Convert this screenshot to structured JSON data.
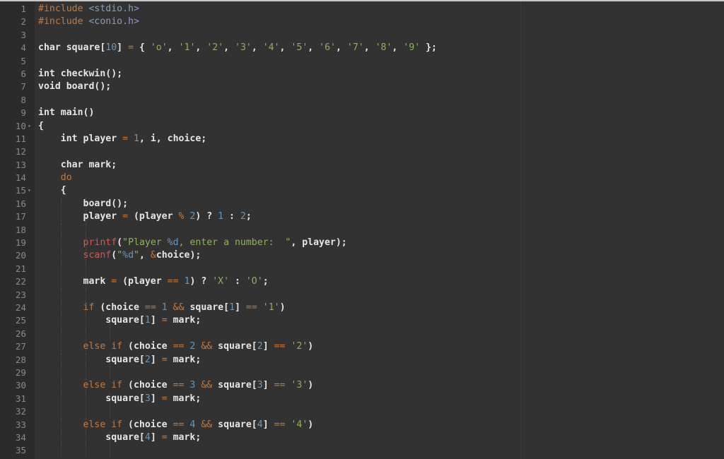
{
  "editor": {
    "language": "c",
    "colors": {
      "background": "#323232",
      "gutter": "#2b2b2b",
      "keyword": "#cc7832",
      "number": "#6897bb",
      "string": "#8fb15a",
      "function": "#d05a4e",
      "text": "#e6e6e6"
    },
    "lines": [
      {
        "n": "1",
        "fold": "",
        "indent": 0,
        "tokens": [
          [
            "pre",
            "#include"
          ],
          [
            "pl",
            " "
          ],
          [
            "inc",
            "<stdio.h>"
          ]
        ]
      },
      {
        "n": "2",
        "fold": "",
        "indent": 0,
        "tokens": [
          [
            "pre",
            "#include"
          ],
          [
            "pl",
            " "
          ],
          [
            "inc",
            "<conio.h>"
          ]
        ]
      },
      {
        "n": "3",
        "fold": "",
        "indent": 0,
        "tokens": []
      },
      {
        "n": "4",
        "fold": "",
        "indent": 0,
        "tokens": [
          [
            "pl",
            "char square["
          ],
          [
            "num",
            "10"
          ],
          [
            "pl",
            "] "
          ],
          [
            "op",
            "="
          ],
          [
            "pl",
            " { "
          ],
          [
            "str",
            "'o'"
          ],
          [
            "pl",
            ", "
          ],
          [
            "str",
            "'1'"
          ],
          [
            "pl",
            ", "
          ],
          [
            "str",
            "'2'"
          ],
          [
            "pl",
            ", "
          ],
          [
            "str",
            "'3'"
          ],
          [
            "pl",
            ", "
          ],
          [
            "str",
            "'4'"
          ],
          [
            "pl",
            ", "
          ],
          [
            "str",
            "'5'"
          ],
          [
            "pl",
            ", "
          ],
          [
            "str",
            "'6'"
          ],
          [
            "pl",
            ", "
          ],
          [
            "str",
            "'7'"
          ],
          [
            "pl",
            ", "
          ],
          [
            "str",
            "'8'"
          ],
          [
            "pl",
            ", "
          ],
          [
            "str",
            "'9'"
          ],
          [
            "pl",
            " };"
          ]
        ]
      },
      {
        "n": "5",
        "fold": "",
        "indent": 0,
        "tokens": []
      },
      {
        "n": "6",
        "fold": "",
        "indent": 0,
        "tokens": [
          [
            "pl",
            "int checkwin();"
          ]
        ]
      },
      {
        "n": "7",
        "fold": "",
        "indent": 0,
        "tokens": [
          [
            "pl",
            "void board();"
          ]
        ]
      },
      {
        "n": "8",
        "fold": "",
        "indent": 0,
        "tokens": []
      },
      {
        "n": "9",
        "fold": "",
        "indent": 0,
        "tokens": [
          [
            "pl",
            "int main()"
          ]
        ]
      },
      {
        "n": "10",
        "fold": "▾",
        "indent": 0,
        "tokens": [
          [
            "pl",
            "{"
          ]
        ]
      },
      {
        "n": "11",
        "fold": "",
        "indent": 1,
        "tokens": [
          [
            "pl",
            "    int player "
          ],
          [
            "op",
            "="
          ],
          [
            "pl",
            " "
          ],
          [
            "num",
            "1"
          ],
          [
            "pl",
            ", i, choice;"
          ]
        ]
      },
      {
        "n": "12",
        "fold": "",
        "indent": 1,
        "tokens": []
      },
      {
        "n": "13",
        "fold": "",
        "indent": 1,
        "tokens": [
          [
            "pl",
            "    char mark;"
          ]
        ]
      },
      {
        "n": "14",
        "fold": "",
        "indent": 1,
        "tokens": [
          [
            "pl",
            "    "
          ],
          [
            "kw",
            "do"
          ]
        ]
      },
      {
        "n": "15",
        "fold": "▾",
        "indent": 1,
        "tokens": [
          [
            "pl",
            "    {"
          ]
        ]
      },
      {
        "n": "16",
        "fold": "",
        "indent": 2,
        "tokens": [
          [
            "pl",
            "        board();"
          ]
        ]
      },
      {
        "n": "17",
        "fold": "",
        "indent": 2,
        "tokens": [
          [
            "pl",
            "        player "
          ],
          [
            "op",
            "="
          ],
          [
            "pl",
            " (player "
          ],
          [
            "op",
            "%"
          ],
          [
            "pl",
            " "
          ],
          [
            "num",
            "2"
          ],
          [
            "pl",
            ") ? "
          ],
          [
            "num",
            "1"
          ],
          [
            "pl",
            " : "
          ],
          [
            "num",
            "2"
          ],
          [
            "pl",
            ";"
          ]
        ]
      },
      {
        "n": "18",
        "fold": "",
        "indent": 2,
        "tokens": []
      },
      {
        "n": "19",
        "fold": "",
        "indent": 2,
        "tokens": [
          [
            "pl",
            "        "
          ],
          [
            "fn",
            "printf"
          ],
          [
            "pl",
            "("
          ],
          [
            "str",
            "\"Player "
          ],
          [
            "fmt",
            "%d"
          ],
          [
            "str",
            ", enter a number:  \""
          ],
          [
            "pl",
            ", player);"
          ]
        ]
      },
      {
        "n": "20",
        "fold": "",
        "indent": 2,
        "tokens": [
          [
            "pl",
            "        "
          ],
          [
            "fn",
            "scanf"
          ],
          [
            "pl",
            "("
          ],
          [
            "str",
            "\""
          ],
          [
            "fmt",
            "%d"
          ],
          [
            "str",
            "\""
          ],
          [
            "pl",
            ", "
          ],
          [
            "op",
            "&"
          ],
          [
            "pl",
            "choice);"
          ]
        ]
      },
      {
        "n": "21",
        "fold": "",
        "indent": 2,
        "tokens": []
      },
      {
        "n": "22",
        "fold": "",
        "indent": 2,
        "tokens": [
          [
            "pl",
            "        mark "
          ],
          [
            "op",
            "="
          ],
          [
            "pl",
            " (player "
          ],
          [
            "op",
            "=="
          ],
          [
            "pl",
            " "
          ],
          [
            "num",
            "1"
          ],
          [
            "pl",
            ") ? "
          ],
          [
            "str",
            "'X'"
          ],
          [
            "pl",
            " : "
          ],
          [
            "str",
            "'O'"
          ],
          [
            "pl",
            ";"
          ]
        ]
      },
      {
        "n": "23",
        "fold": "",
        "indent": 2,
        "tokens": []
      },
      {
        "n": "24",
        "fold": "",
        "indent": 2,
        "tokens": [
          [
            "pl",
            "        "
          ],
          [
            "kw",
            "if"
          ],
          [
            "pl",
            " (choice "
          ],
          [
            "op",
            "=="
          ],
          [
            "pl",
            " "
          ],
          [
            "num",
            "1"
          ],
          [
            "pl",
            " "
          ],
          [
            "op",
            "&&"
          ],
          [
            "pl",
            " square["
          ],
          [
            "num",
            "1"
          ],
          [
            "pl",
            "] "
          ],
          [
            "op",
            "=="
          ],
          [
            "pl",
            " "
          ],
          [
            "str",
            "'1'"
          ],
          [
            "pl",
            ")"
          ]
        ]
      },
      {
        "n": "25",
        "fold": "",
        "indent": 3,
        "tokens": [
          [
            "pl",
            "            square["
          ],
          [
            "num",
            "1"
          ],
          [
            "pl",
            "] "
          ],
          [
            "op",
            "="
          ],
          [
            "pl",
            " mark;"
          ]
        ]
      },
      {
        "n": "26",
        "fold": "",
        "indent": 3,
        "tokens": []
      },
      {
        "n": "27",
        "fold": "",
        "indent": 2,
        "tokens": [
          [
            "pl",
            "        "
          ],
          [
            "kw",
            "else if"
          ],
          [
            "pl",
            " (choice "
          ],
          [
            "op",
            "=="
          ],
          [
            "pl",
            " "
          ],
          [
            "num",
            "2"
          ],
          [
            "pl",
            " "
          ],
          [
            "op",
            "&&"
          ],
          [
            "pl",
            " square["
          ],
          [
            "num",
            "2"
          ],
          [
            "pl",
            "] "
          ],
          [
            "op",
            "=="
          ],
          [
            "pl",
            " "
          ],
          [
            "str",
            "'2'"
          ],
          [
            "pl",
            ")"
          ]
        ]
      },
      {
        "n": "28",
        "fold": "",
        "indent": 3,
        "tokens": [
          [
            "pl",
            "            square["
          ],
          [
            "num",
            "2"
          ],
          [
            "pl",
            "] "
          ],
          [
            "op",
            "="
          ],
          [
            "pl",
            " mark;"
          ]
        ]
      },
      {
        "n": "29",
        "fold": "",
        "indent": 3,
        "tokens": []
      },
      {
        "n": "30",
        "fold": "",
        "indent": 2,
        "tokens": [
          [
            "pl",
            "        "
          ],
          [
            "kw",
            "else if"
          ],
          [
            "pl",
            " (choice "
          ],
          [
            "op",
            "=="
          ],
          [
            "pl",
            " "
          ],
          [
            "num",
            "3"
          ],
          [
            "pl",
            " "
          ],
          [
            "op",
            "&&"
          ],
          [
            "pl",
            " square["
          ],
          [
            "num",
            "3"
          ],
          [
            "pl",
            "] "
          ],
          [
            "op",
            "=="
          ],
          [
            "pl",
            " "
          ],
          [
            "str",
            "'3'"
          ],
          [
            "pl",
            ")"
          ]
        ]
      },
      {
        "n": "31",
        "fold": "",
        "indent": 3,
        "tokens": [
          [
            "pl",
            "            square["
          ],
          [
            "num",
            "3"
          ],
          [
            "pl",
            "] "
          ],
          [
            "op",
            "="
          ],
          [
            "pl",
            " mark;"
          ]
        ]
      },
      {
        "n": "32",
        "fold": "",
        "indent": 3,
        "tokens": []
      },
      {
        "n": "33",
        "fold": "",
        "indent": 2,
        "tokens": [
          [
            "pl",
            "        "
          ],
          [
            "kw",
            "else if"
          ],
          [
            "pl",
            " (choice "
          ],
          [
            "op",
            "=="
          ],
          [
            "pl",
            " "
          ],
          [
            "num",
            "4"
          ],
          [
            "pl",
            " "
          ],
          [
            "op",
            "&&"
          ],
          [
            "pl",
            " square["
          ],
          [
            "num",
            "4"
          ],
          [
            "pl",
            "] "
          ],
          [
            "op",
            "=="
          ],
          [
            "pl",
            " "
          ],
          [
            "str",
            "'4'"
          ],
          [
            "pl",
            ")"
          ]
        ]
      },
      {
        "n": "34",
        "fold": "",
        "indent": 3,
        "tokens": [
          [
            "pl",
            "            square["
          ],
          [
            "num",
            "4"
          ],
          [
            "pl",
            "] "
          ],
          [
            "op",
            "="
          ],
          [
            "pl",
            " mark;"
          ]
        ]
      },
      {
        "n": "35",
        "fold": "",
        "indent": 3,
        "tokens": []
      }
    ]
  }
}
